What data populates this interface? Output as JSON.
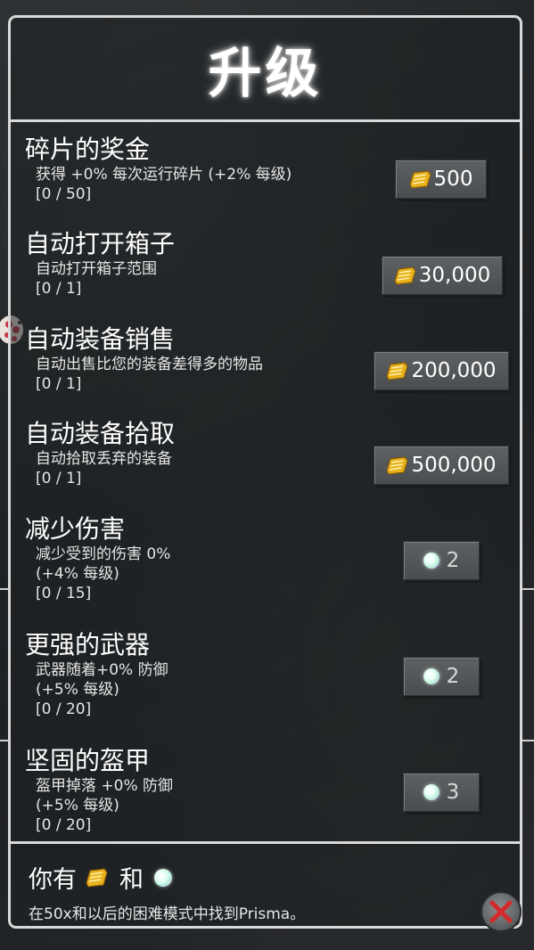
{
  "header": {
    "title": "升级"
  },
  "upgrades": [
    {
      "title": "碎片的奖金",
      "desc": "获得 +0% 每次运行碎片 (+2% 每级)",
      "progress": "[0 / 50]",
      "cost": "500",
      "currency": "shard"
    },
    {
      "title": "自动打开箱子",
      "desc": "自动打开箱子范围",
      "progress": "[0 / 1]",
      "cost": "30,000",
      "currency": "shard"
    },
    {
      "title": "自动装备销售",
      "desc": "自动出售比您的装备差得多的物品",
      "progress": "[0 / 1]",
      "cost": "200,000",
      "currency": "shard"
    },
    {
      "title": "自动装备拾取",
      "desc": "自动拾取丢弃的装备",
      "progress": "[0 / 1]",
      "cost": "500,000",
      "currency": "shard"
    },
    {
      "title": "减少伤害",
      "desc": "减少受到的伤害 0%\n(+4% 每级)",
      "progress": "[0 / 15]",
      "cost": "2",
      "currency": "prisma"
    },
    {
      "title": "更强的武器",
      "desc": "武器随着+0% 防御\n(+5% 每级)",
      "progress": "[0 / 20]",
      "cost": "2",
      "currency": "prisma"
    },
    {
      "title": "坚固的盔甲",
      "desc": "盔甲掉落 +0% 防御\n(+5% 每级)",
      "progress": "[0 / 20]",
      "cost": "3",
      "currency": "prisma"
    }
  ],
  "footer": {
    "you_have": "你有",
    "and": "和",
    "note": "在50x和以后的困难模式中找到Prisma。"
  },
  "icons": {
    "shard": "shard-coin-icon",
    "prisma": "prisma-gem-icon",
    "close": "close-x-icon"
  },
  "colors": {
    "panel_border": "#d9d9d9",
    "button_face": "#54575a",
    "shard_gold": "#e8b21e",
    "close_red": "#d42a2a"
  }
}
